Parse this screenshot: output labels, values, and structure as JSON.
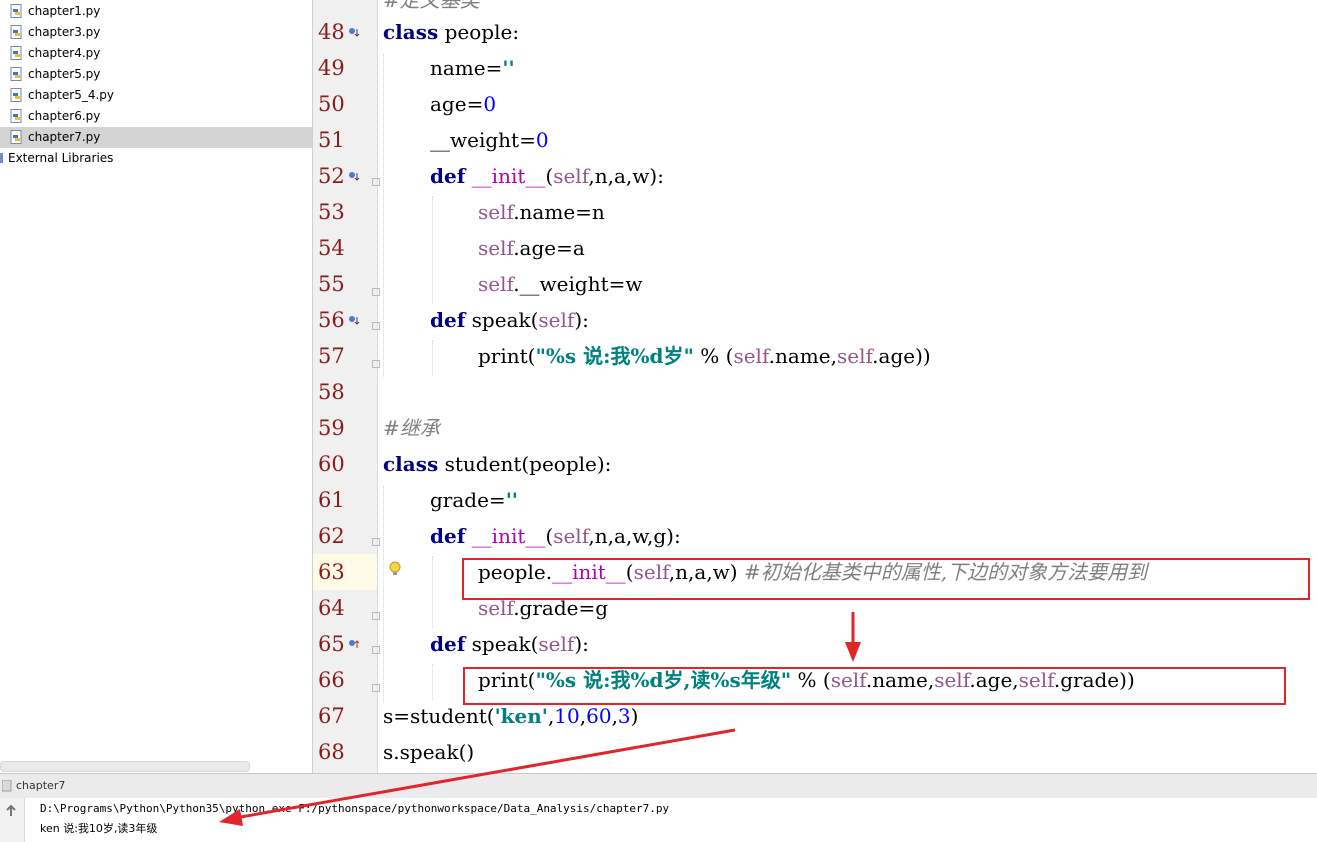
{
  "project_tree": {
    "files": [
      {
        "name": "chapter1.py",
        "selected": false
      },
      {
        "name": "chapter3.py",
        "selected": false
      },
      {
        "name": "chapter4.py",
        "selected": false
      },
      {
        "name": "chapter5.py",
        "selected": false
      },
      {
        "name": "chapter5_4.py",
        "selected": false
      },
      {
        "name": "chapter6.py",
        "selected": false
      },
      {
        "name": "chapter7.py",
        "selected": true
      }
    ],
    "external_libraries": "External Libraries"
  },
  "editor": {
    "partial_top_comment": "#定义基类",
    "lines": [
      {
        "num": "48",
        "text": "class people:"
      },
      {
        "num": "49",
        "text": "name=''"
      },
      {
        "num": "50",
        "text": "age=0"
      },
      {
        "num": "51",
        "text": "__weight=0"
      },
      {
        "num": "52",
        "text": "def __init__(self,n,a,w):"
      },
      {
        "num": "53",
        "text": "self.name=n"
      },
      {
        "num": "54",
        "text": "self.age=a"
      },
      {
        "num": "55",
        "text": "self.__weight=w"
      },
      {
        "num": "56",
        "text": "def speak(self):"
      },
      {
        "num": "57",
        "text": "print(\"%s 说:我%d岁\" % (self.name,self.age))"
      },
      {
        "num": "58",
        "text": ""
      },
      {
        "num": "59",
        "text": "#继承"
      },
      {
        "num": "60",
        "text": "class student(people):"
      },
      {
        "num": "61",
        "text": "grade=''"
      },
      {
        "num": "62",
        "text": "def __init__(self,n,a,w,g):"
      },
      {
        "num": "63",
        "text": "people.__init__(self,n,a,w) #初始化基类中的属性,下边的对象方法要用到"
      },
      {
        "num": "64",
        "text": "self.grade=g"
      },
      {
        "num": "65",
        "text": "def speak(self):"
      },
      {
        "num": "66",
        "text": "print(\"%s 说:我%d岁,读%s年级\" % (self.name,self.age,self.grade))"
      },
      {
        "num": "67",
        "text": "s=student('ken',10,60,3)"
      },
      {
        "num": "68",
        "text": "s.speak()"
      }
    ],
    "highlighted_line": "63"
  },
  "run_panel": {
    "title": "chapter7",
    "command": "D:\\Programs\\Python\\Python35\\python.exe F:/pythonspace/pythonworkspace/Data_Analysis/chapter7.py",
    "output": "ken 说:我10岁,读3年级"
  },
  "colors": {
    "annotation_red": "#e0262a",
    "keyword": "#000080",
    "self": "#94558d",
    "number": "#0000ff",
    "string": "#008080",
    "comment": "#808080",
    "line_number": "#8a1b1b"
  }
}
